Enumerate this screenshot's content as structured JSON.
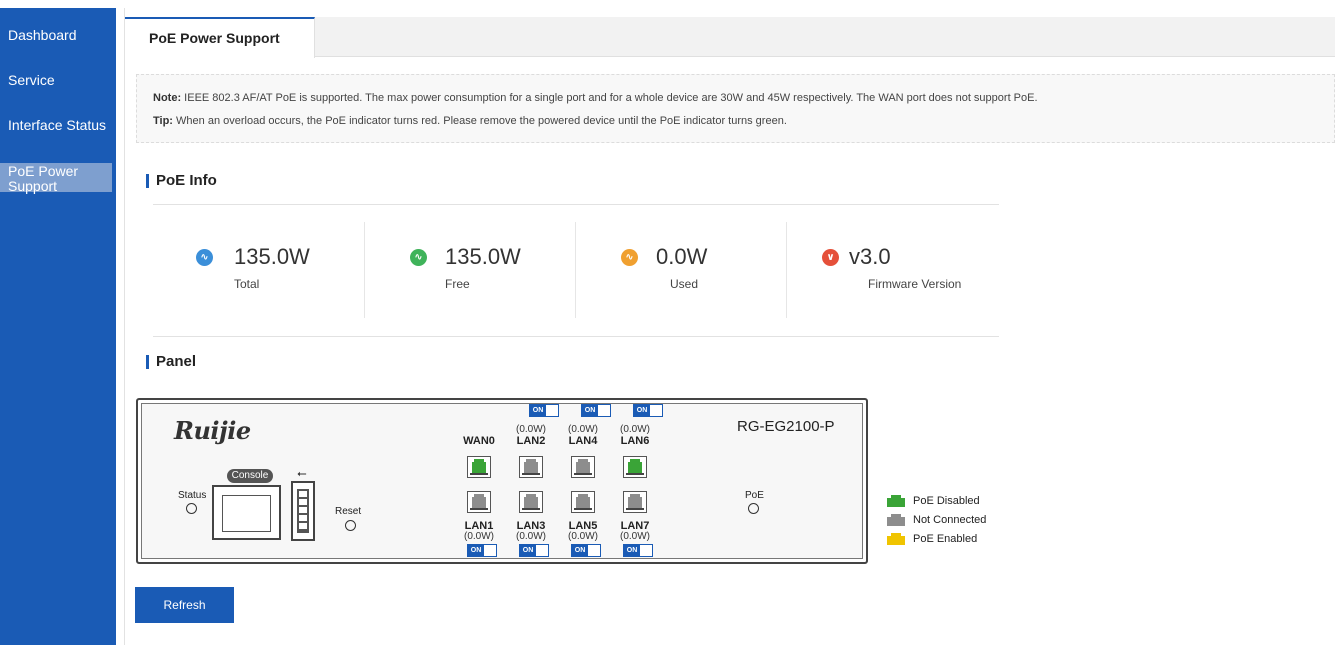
{
  "sidebar": {
    "items": [
      {
        "label": "Dashboard"
      },
      {
        "label": "Service"
      },
      {
        "label": "Interface Status"
      },
      {
        "label": "PoE Power Support",
        "active": true
      }
    ]
  },
  "tabs": [
    {
      "label": "PoE Power Support",
      "active": true
    }
  ],
  "note": {
    "note_prefix": "Note:",
    "note_text": "IEEE 802.3 AF/AT PoE is supported. The max power consumption for a single port and for a whole device are 30W and 45W respectively. The WAN port does not support PoE.",
    "tip_prefix": "Tip:",
    "tip_text": "When an overload occurs, the PoE indicator turns red. Please remove the powered device until the PoE indicator turns green."
  },
  "poe_info": {
    "title": "PoE Info",
    "items": [
      {
        "value": "135.0W",
        "label": "Total",
        "icon": "pulse-icon",
        "color": "#3b8fd9"
      },
      {
        "value": "135.0W",
        "label": "Free",
        "icon": "pulse-icon",
        "color": "#3fb35a"
      },
      {
        "value": "0.0W",
        "label": "Used",
        "icon": "pulse-icon",
        "color": "#f0a030"
      },
      {
        "value": "v3.0",
        "label": "Firmware Version",
        "icon": "chevron-down-icon",
        "color": "#e5503a"
      }
    ]
  },
  "panel": {
    "title": "Panel",
    "brand": "Ruijie",
    "model": "RG-EG2100-P",
    "console_label": "Console",
    "status_label": "Status",
    "reset_label": "Reset",
    "poe_label": "PoE",
    "usb_symbol": "⭠",
    "toggle_label": "ON",
    "top_ports": [
      {
        "name": "WAN0",
        "watt": "",
        "state": "green",
        "toggle": false
      },
      {
        "name": "LAN2",
        "watt": "(0.0W)",
        "state": "gray",
        "toggle": true
      },
      {
        "name": "LAN4",
        "watt": "(0.0W)",
        "state": "gray",
        "toggle": true
      },
      {
        "name": "LAN6",
        "watt": "(0.0W)",
        "state": "green",
        "toggle": true
      }
    ],
    "bottom_ports": [
      {
        "name": "LAN1",
        "watt": "(0.0W)",
        "state": "gray",
        "toggle": true
      },
      {
        "name": "LAN3",
        "watt": "(0.0W)",
        "state": "gray",
        "toggle": true
      },
      {
        "name": "LAN5",
        "watt": "(0.0W)",
        "state": "gray",
        "toggle": true
      },
      {
        "name": "LAN7",
        "watt": "(0.0W)",
        "state": "gray",
        "toggle": true
      }
    ]
  },
  "legend": [
    {
      "label": "PoE Disabled",
      "color": "#3aa437"
    },
    {
      "label": "Not Connected",
      "color": "#8d8d8d"
    },
    {
      "label": "PoE Enabled",
      "color": "#f0c400"
    }
  ],
  "refresh_label": "Refresh"
}
